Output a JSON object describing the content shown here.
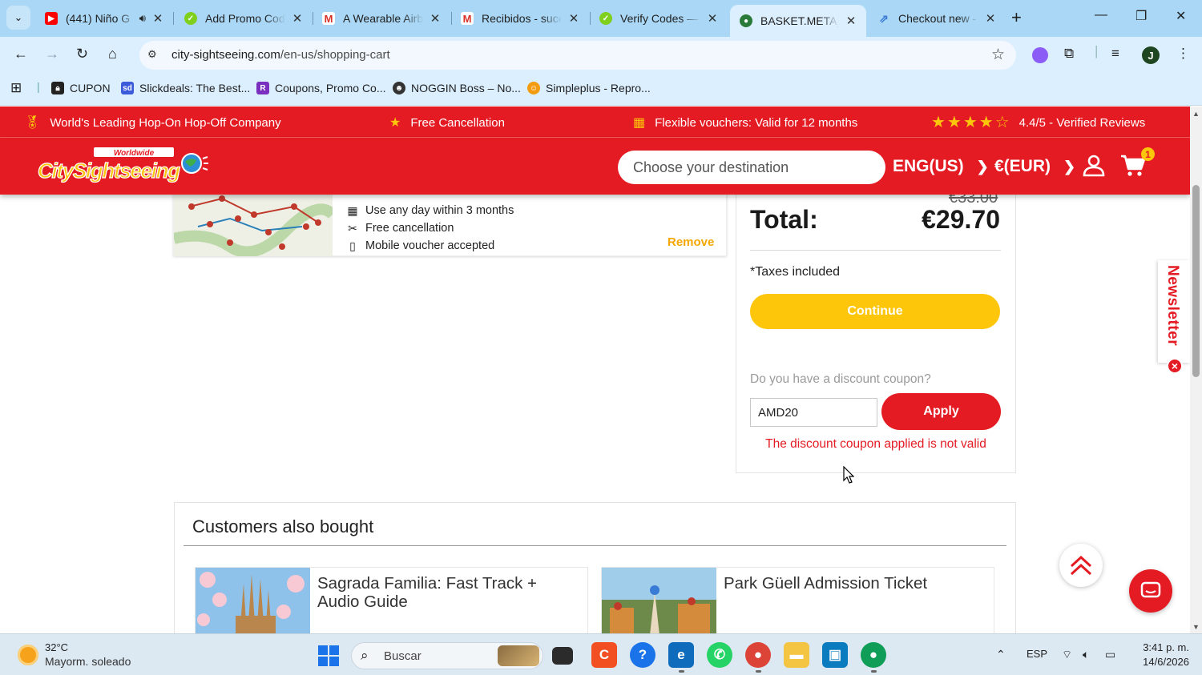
{
  "browser": {
    "tabs": [
      {
        "title": "(441) Niño G",
        "favicon": "youtube-icon",
        "has_audio": true
      },
      {
        "title": "Add Promo Cod",
        "favicon": "green-check-icon"
      },
      {
        "title": "A Wearable Airb",
        "favicon": "gmail-icon"
      },
      {
        "title": "Recibidos - suce",
        "favicon": "gmail-icon"
      },
      {
        "title": "Verify Codes —",
        "favicon": "green-check-icon"
      },
      {
        "title": "BASKET.META_TI",
        "favicon": "city-sightseeing-icon",
        "active": true
      },
      {
        "title": "Checkout new -",
        "favicon": "checkout-icon"
      }
    ],
    "url": {
      "host": "city-sightseeing.com",
      "path": "/en-us/shopping-cart"
    },
    "profile_initial": "J",
    "bookmarks": [
      {
        "label": "CUPON",
        "icon": "lock-icon"
      },
      {
        "label": "Slickdeals: The Best...",
        "icon": "slickdeals-icon"
      },
      {
        "label": "Coupons, Promo Co...",
        "icon": "coupons-icon"
      },
      {
        "label": "NOGGIN Boss – No...",
        "icon": "noggin-icon"
      },
      {
        "label": "Simpleplus - Repro...",
        "icon": "simpleplus-icon"
      }
    ]
  },
  "site": {
    "promo_bar": {
      "item1": "World's Leading Hop-On Hop-Off Company",
      "item2": "Free Cancellation",
      "item3": "Flexible vouchers: Valid for 12 months",
      "rating": "4.4/5 - Verified Reviews",
      "rating_stars": 4.5
    },
    "header": {
      "logo_top": "Worldwide",
      "logo_main": "CitySightseeing",
      "search_placeholder": "Choose your destination",
      "language": "ENG(US)",
      "currency": "€(EUR)",
      "cart_count": "1"
    },
    "product": {
      "features": [
        "Use any day within 3 months",
        "Free cancellation",
        "Mobile voucher accepted"
      ],
      "remove": "Remove"
    },
    "summary": {
      "old_price": "€33.00",
      "total_label": "Total:",
      "total": "€29.70",
      "taxes": "*Taxes included",
      "continue": "Continue",
      "coupon_question": "Do you have a discount coupon?",
      "coupon_value": "AMD20",
      "apply": "Apply",
      "coupon_error": "The discount coupon applied is not valid"
    },
    "newsletter": "Newsletter",
    "also_bought": {
      "title": "Customers also bought",
      "items": [
        {
          "title": "Sagrada Familia: Fast Track + Audio Guide"
        },
        {
          "title": "Park Güell Admission Ticket"
        }
      ]
    }
  },
  "taskbar": {
    "weather_temp": "32°C",
    "weather_desc": "Mayorm. soleado",
    "search_label": "Buscar",
    "language": "ESP",
    "time": "3:41 p. m.",
    "date": "14/6/2026"
  },
  "colors": {
    "brand_red": "#e41b23",
    "brand_yellow": "#fdc60b",
    "chrome_blue": "#a9d7f5"
  }
}
